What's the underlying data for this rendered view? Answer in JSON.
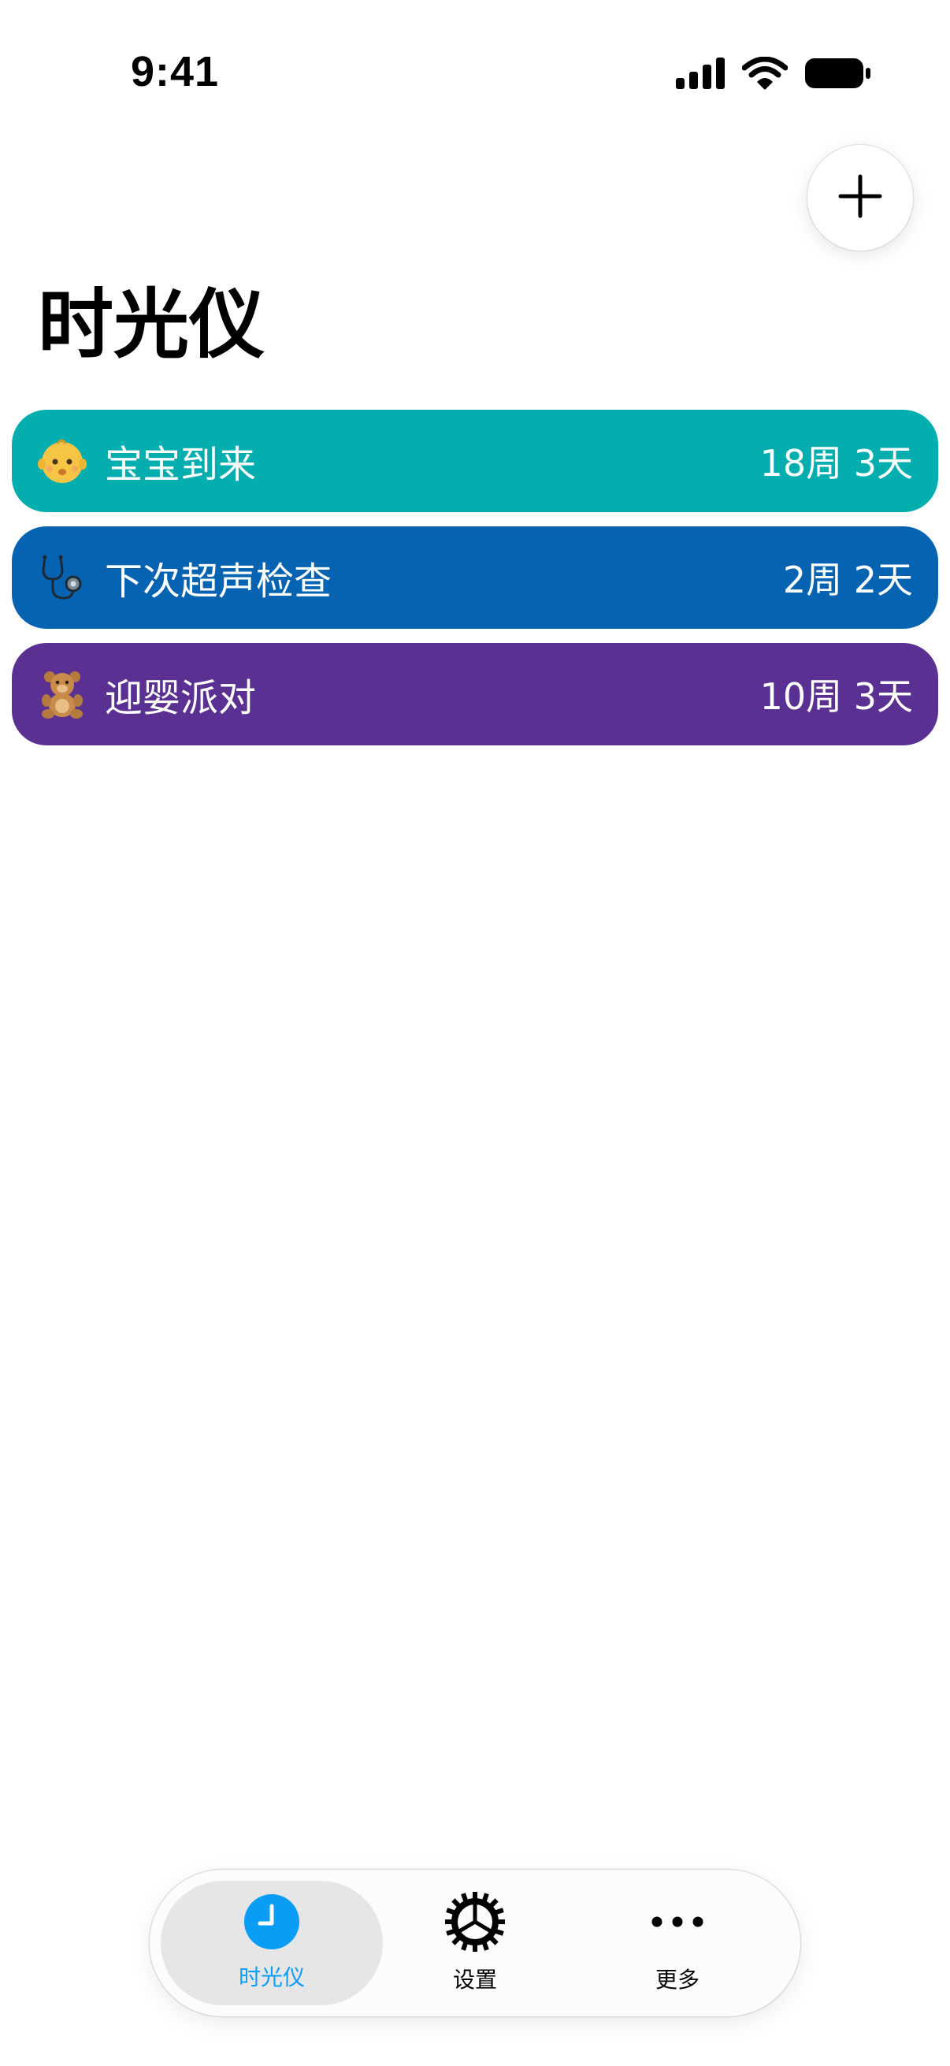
{
  "status_bar": {
    "time": "9:41"
  },
  "header": {
    "add_icon": "plus-icon",
    "title": "时光仪"
  },
  "events": [
    {
      "emoji": "baby-emoji",
      "title": "宝宝到来",
      "remaining": "18周 3天",
      "color": "#05AEAE"
    },
    {
      "emoji": "stethoscope-emoji",
      "title": "下次超声检查",
      "remaining": "2周 2天",
      "color": "#0563B2"
    },
    {
      "emoji": "teddy-bear-emoji",
      "title": "迎婴派对",
      "remaining": "10周 3天",
      "color": "#5A3192"
    }
  ],
  "tab_bar": {
    "tabs": [
      {
        "label": "时光仪",
        "icon": "clock-icon",
        "active": true,
        "color": "#0A9DF5"
      },
      {
        "label": "设置",
        "icon": "gear-icon",
        "active": false,
        "color": "#000000"
      },
      {
        "label": "更多",
        "icon": "ellipsis-icon",
        "active": false,
        "color": "#000000"
      }
    ]
  }
}
